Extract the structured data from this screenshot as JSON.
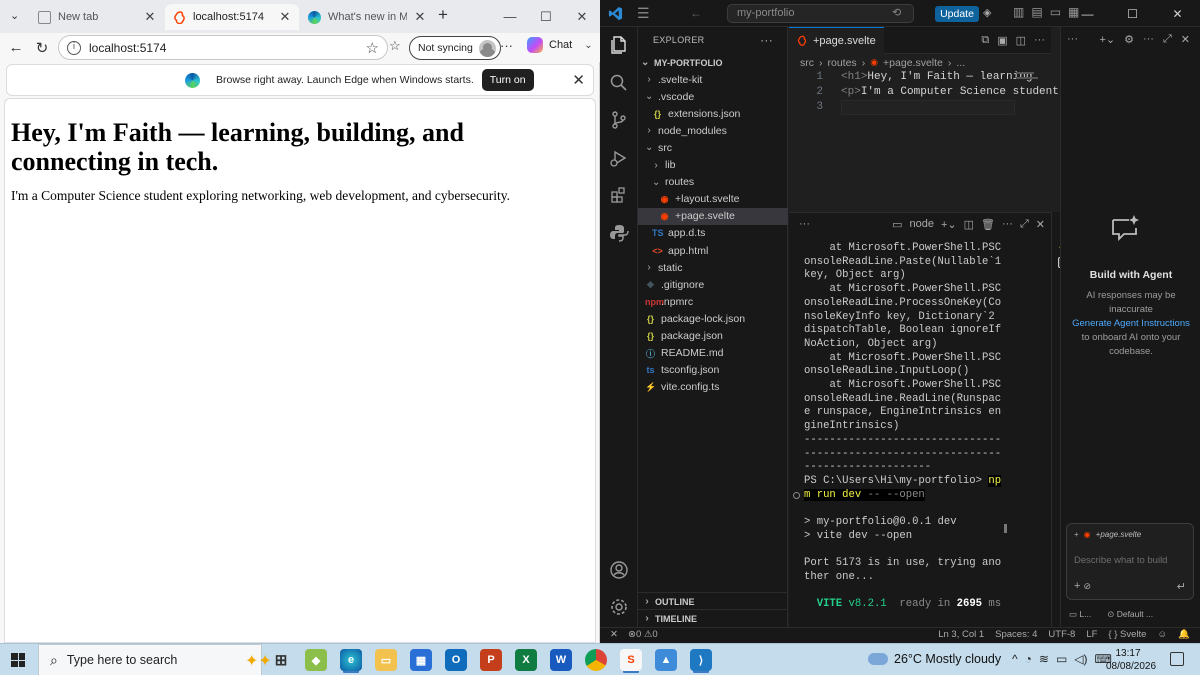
{
  "browser": {
    "tabs": [
      {
        "title": "New tab",
        "active": false
      },
      {
        "title": "localhost:5174",
        "active": true
      },
      {
        "title": "What's new in Micro",
        "active": false
      }
    ],
    "address": "localhost:5174",
    "profile_label": "Not syncing",
    "chat_label": "Chat",
    "banner": {
      "message": "Browse right away. Launch Edge when Windows starts.",
      "button": "Turn on"
    },
    "page": {
      "heading": "Hey, I'm Faith — learning, building, and connecting in tech.",
      "paragraph": "I'm a Computer Science student exploring networking, web development, and cybersecurity."
    }
  },
  "vscode": {
    "search_placeholder": "my-portfolio",
    "update_label": "Update",
    "explorer": {
      "title": "EXPLORER",
      "root": "MY-PORTFOLIO",
      "items": [
        {
          "label": ".svelte-kit",
          "kind": "folder",
          "open": false,
          "depth": 1
        },
        {
          "label": ".vscode",
          "kind": "folder",
          "open": true,
          "depth": 1
        },
        {
          "label": "extensions.json",
          "kind": "json",
          "depth": 2
        },
        {
          "label": "node_modules",
          "kind": "folder",
          "open": false,
          "depth": 1
        },
        {
          "label": "src",
          "kind": "folder",
          "open": true,
          "depth": 1
        },
        {
          "label": "lib",
          "kind": "folder",
          "open": false,
          "depth": 2
        },
        {
          "label": "routes",
          "kind": "folder",
          "open": true,
          "depth": 2
        },
        {
          "label": "+layout.svelte",
          "kind": "svelte",
          "depth": 3
        },
        {
          "label": "+page.svelte",
          "kind": "svelte",
          "depth": 3,
          "selected": true
        },
        {
          "label": "app.d.ts",
          "kind": "ts",
          "depth": 2
        },
        {
          "label": "app.html",
          "kind": "html",
          "depth": 2
        },
        {
          "label": "static",
          "kind": "folder",
          "open": false,
          "depth": 1
        },
        {
          "label": ".gitignore",
          "kind": "git",
          "depth": 1
        },
        {
          "label": ".npmrc",
          "kind": "npm",
          "depth": 1
        },
        {
          "label": "package-lock.json",
          "kind": "json",
          "depth": 1
        },
        {
          "label": "package.json",
          "kind": "json",
          "depth": 1
        },
        {
          "label": "README.md",
          "kind": "info",
          "depth": 1
        },
        {
          "label": "tsconfig.json",
          "kind": "tsconfig",
          "depth": 1
        },
        {
          "label": "vite.config.ts",
          "kind": "vite",
          "depth": 1
        }
      ],
      "outline": "OUTLINE",
      "timeline": "TIMELINE"
    },
    "editor": {
      "tab": "+page.svelte",
      "breadcrumb": [
        "src",
        "routes",
        "+page.svelte",
        "..."
      ],
      "lines": [
        {
          "no": "1",
          "open": "<h1>",
          "text": "Hey, I'm Faith — learning"
        },
        {
          "no": "2",
          "open": "<p>",
          "text": "I'm a Computer Science student"
        },
        {
          "no": "3",
          "open": "",
          "text": ""
        }
      ]
    },
    "terminal": {
      "shell": "node",
      "trace": "    at Microsoft.PowerShell.PSConsoleReadLine.Paste(Nullable`1 key, Object arg)\n    at Microsoft.PowerShell.PSConsoleReadLine.ProcessOneKey(ConsoleKeyInfo key, Dictionary`2 dispatchTable, Boolean ignoreIfNoAction, Object arg)\n    at Microsoft.PowerShell.PSConsoleReadLine.InputLoop()\n    at Microsoft.PowerShell.PSConsoleReadLine.ReadLine(Runspace runspace, EngineIntrinsics engineIntrinsics)",
      "separator": "----------------------------------------------------------------------------------",
      "prompt": "PS C:\\Users\\Hi\\my-portfolio>",
      "cmd_npm": "npm run dev",
      "cmd_rest": " -- --open",
      "out1": "> my-portfolio@0.0.1 dev",
      "out2": "> vite dev --open",
      "out3": "Port 5173 is in use, trying another one...",
      "vite_label": "VITE",
      "vite_ver": "v8.2.1",
      "ready_text": "ready in",
      "ready_ms": "2695",
      "ms": "ms"
    },
    "chat": {
      "title": "Build with Agent",
      "line1": "AI responses may be inaccurate",
      "link": "Generate Agent Instructions",
      "line2": "to onboard AI onto your codebase.",
      "chip": "+page.svelte",
      "placeholder": "Describe what to build",
      "foot_left": "L...",
      "foot_right": "Default ..."
    },
    "status": {
      "errors": "0",
      "warnings": "0",
      "position": "Ln 3, Col 1",
      "spaces": "Spaces: 4",
      "encoding": "UTF-8",
      "eol": "LF",
      "language": "Svelte"
    },
    "badge": "1"
  },
  "taskbar": {
    "search": "Type here to search",
    "weather": "26°C  Mostly cloudy",
    "time": "13:17",
    "date": "08/08/2026"
  }
}
